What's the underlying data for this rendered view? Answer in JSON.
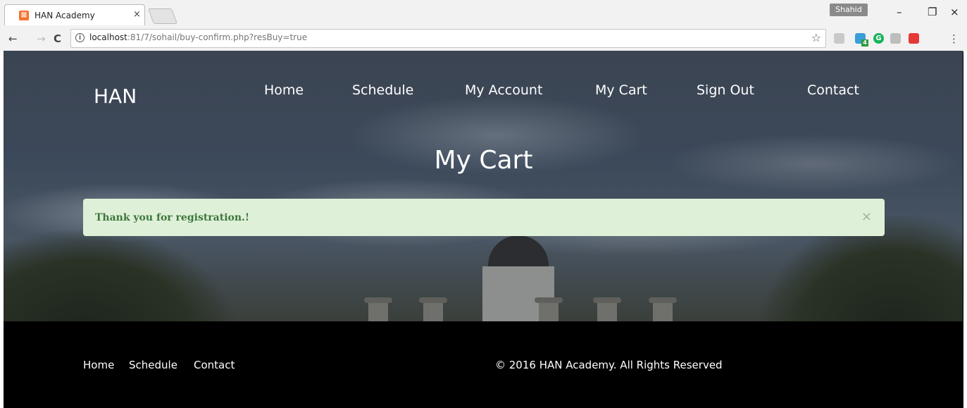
{
  "browser": {
    "tab_title": "HAN Academy",
    "tab_close": "×",
    "profile": "Shahid",
    "url_host": "localhost",
    "url_rest": ":81/7/sohail/buy-confirm.php?resBuy=true",
    "window_minimize": "–",
    "window_restore": "❐",
    "window_close": "×",
    "back": "←",
    "forward": "→",
    "reload": "C",
    "bookmark_star": "☆",
    "ext_badge": "4"
  },
  "header": {
    "brand": "HAN",
    "nav": [
      "Home",
      "Schedule",
      "My Account",
      "My Cart",
      "Sign Out",
      "Contact"
    ]
  },
  "page": {
    "title": "My Cart",
    "alert_message": "Thank you for registration.!",
    "alert_close": "×"
  },
  "footer": {
    "links": [
      "Home",
      "Schedule",
      "Contact"
    ],
    "copyright": "© 2016 HAN Academy. All Rights Reserved"
  },
  "colors": {
    "alert_bg": "#dff0d8",
    "alert_text": "#3c763d",
    "footer_bg": "#000000"
  }
}
